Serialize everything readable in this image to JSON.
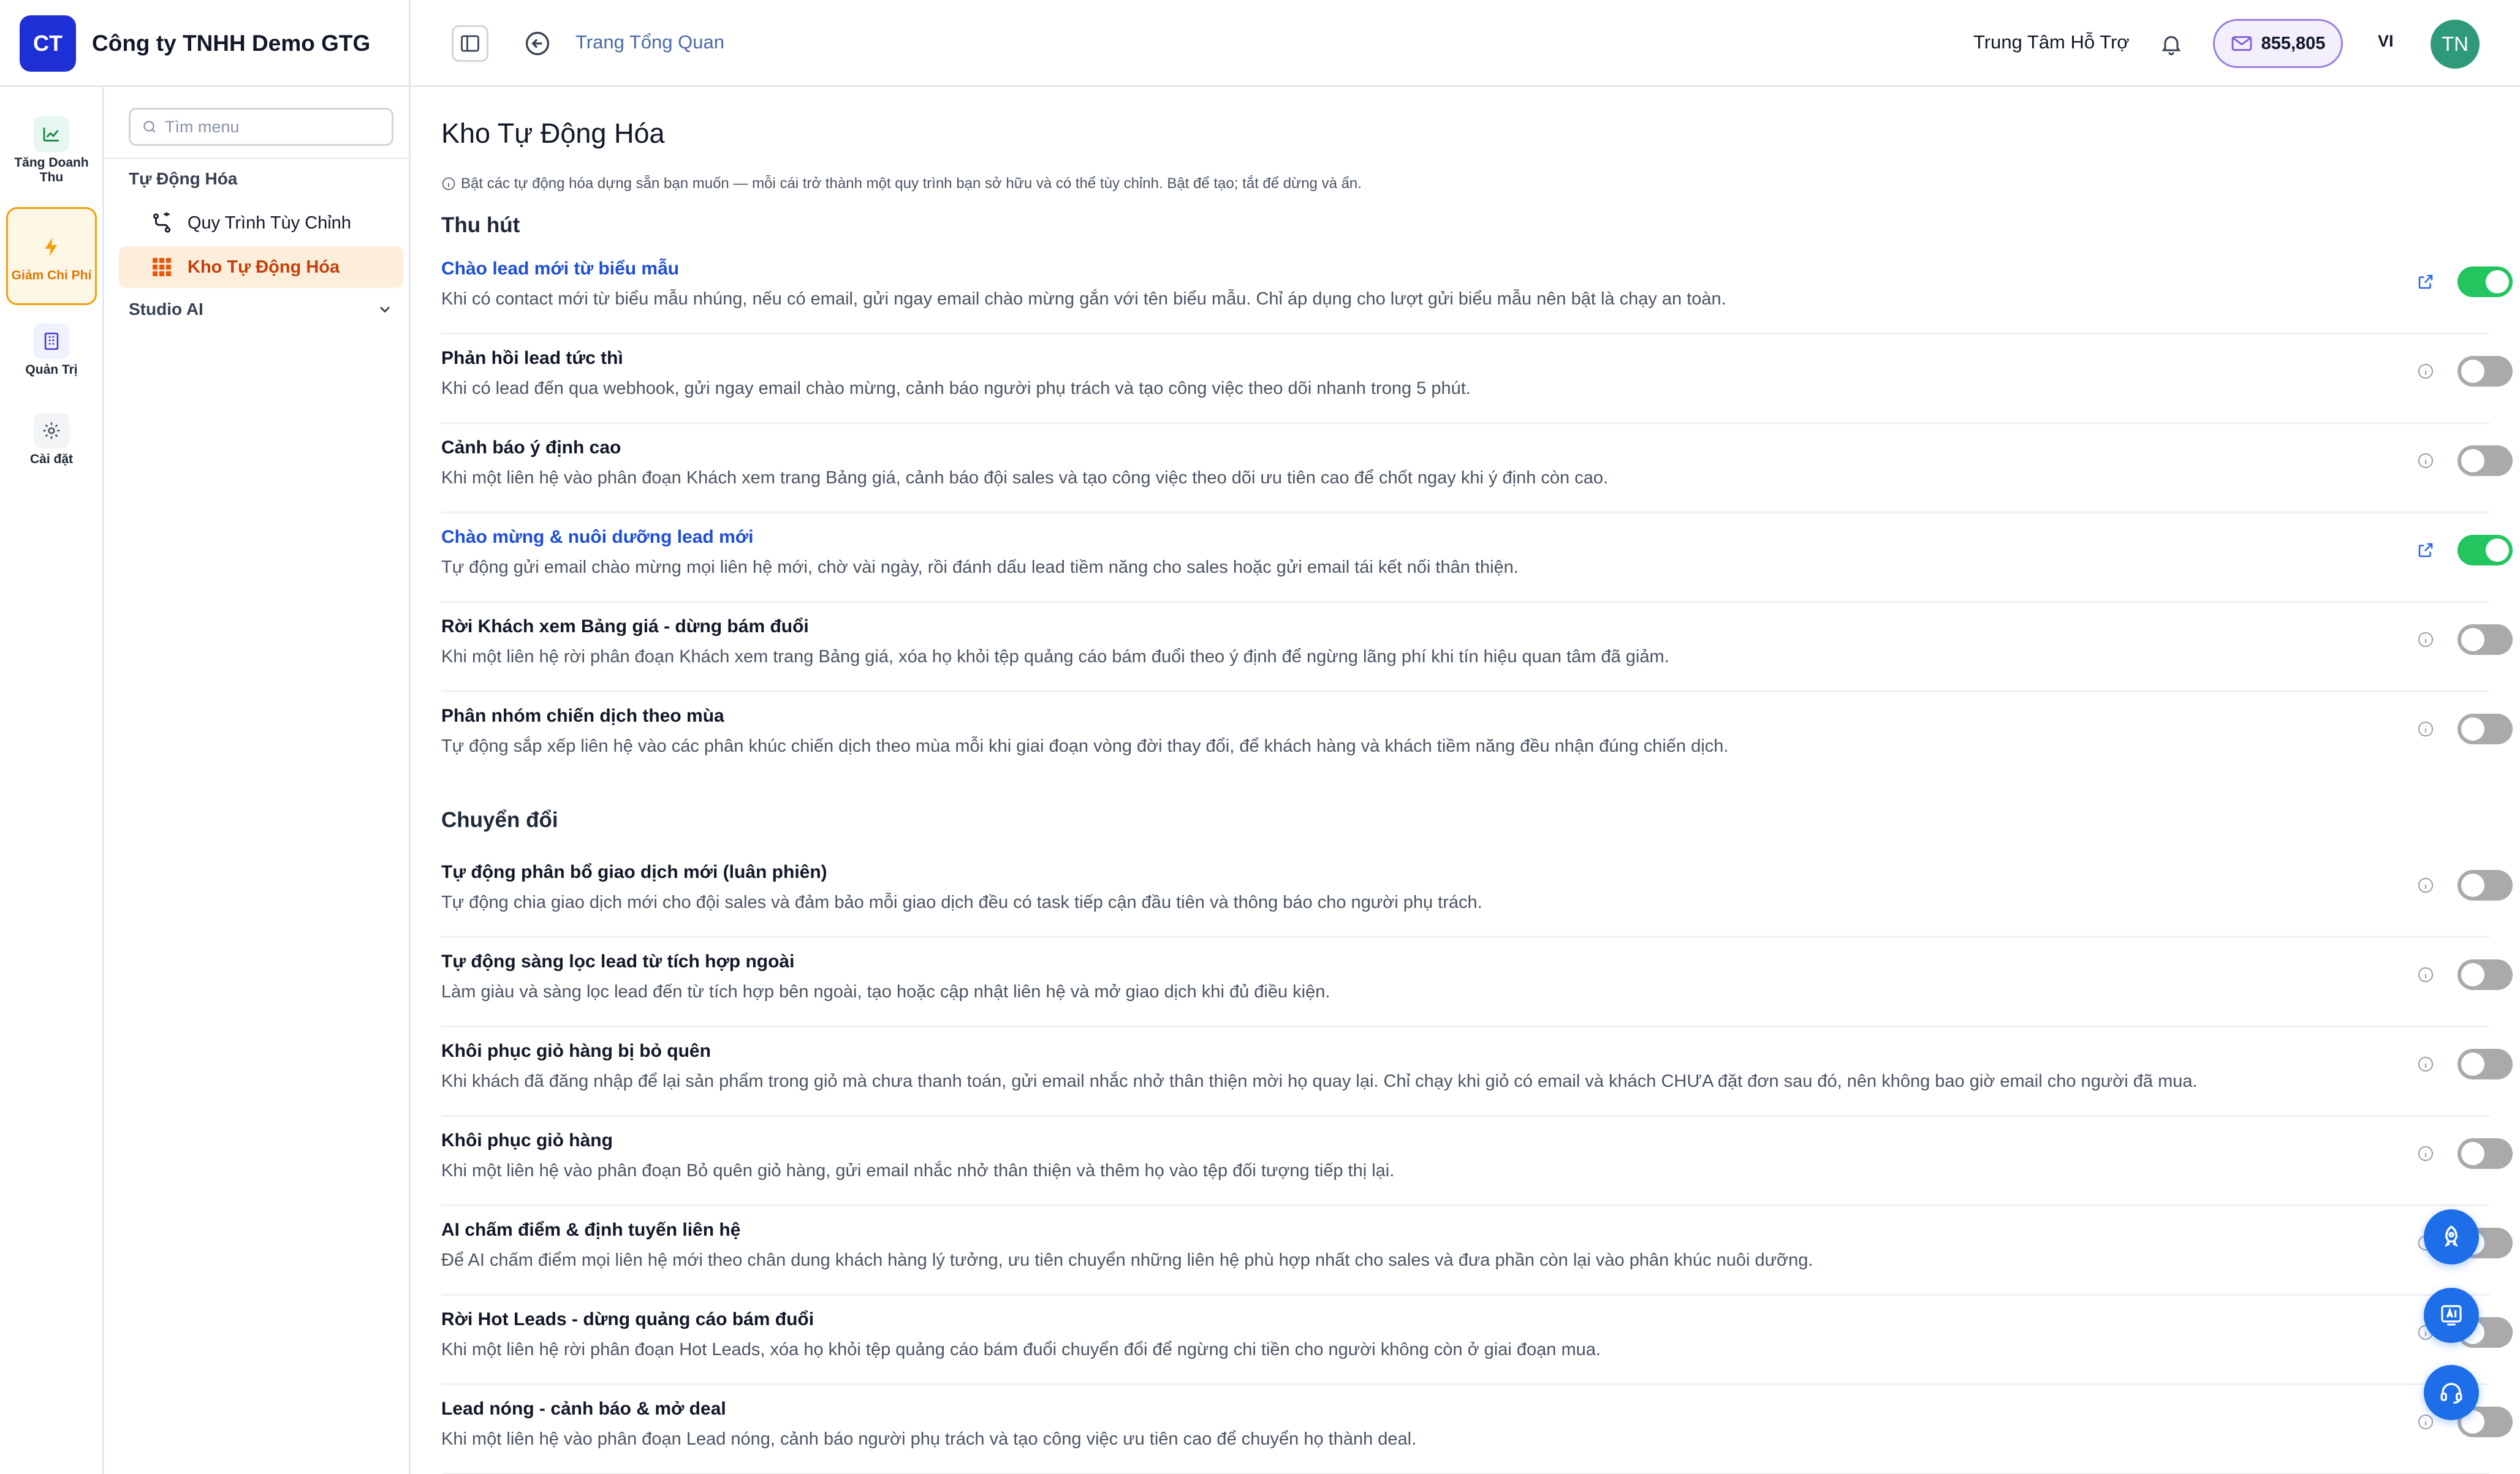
{
  "company": {
    "logo_text": "CT",
    "name": "Công ty TNHH Demo GTG"
  },
  "header": {
    "breadcrumb": "Trang Tổng Quan",
    "support_label": "Trung Tâm Hỗ Trợ",
    "credits": "855,805",
    "language": "VI",
    "avatar_initials": "TN"
  },
  "rail": [
    {
      "label": "Tăng Doanh Thu",
      "icon": "trending-up-icon"
    },
    {
      "label": "Giảm Chi Phí",
      "icon": "lightning-icon",
      "active": true
    },
    {
      "label": "Quản Trị",
      "icon": "building-icon"
    },
    {
      "label": "Cài đặt",
      "icon": "gear-icon"
    }
  ],
  "menu": {
    "search_placeholder": "Tìm menu",
    "group_label": "Tự Động Hóa",
    "items": [
      {
        "label": "Quy Trình Tùy Chỉnh",
        "icon": "workflow-icon"
      },
      {
        "label": "Kho Tự Động Hóa",
        "icon": "grid-icon",
        "active": true
      }
    ],
    "studio_label": "Studio AI"
  },
  "main": {
    "title": "Kho Tự Động Hóa",
    "info": "Bật các tự động hóa dựng sẵn bạn muốn — mỗi cái trở thành một quy trình bạn sở hữu và có thể tùy chỉnh. Bật để tạo; tắt để dừng và ẩn.",
    "sections": [
      {
        "title": "Thu hút",
        "items": [
          {
            "title": "Chào lead mới từ biểu mẫu",
            "desc": "Khi có contact mới từ biểu mẫu nhúng, nếu có email, gửi ngay email chào mừng gắn với tên biểu mẫu. Chỉ áp dụng cho lượt gửi biểu mẫu nên bật là chạy an toàn.",
            "enabled": true
          },
          {
            "title": "Phản hồi lead tức thì",
            "desc": "Khi có lead đến qua webhook, gửi ngay email chào mừng, cảnh báo người phụ trách và tạo công việc theo dõi nhanh trong 5 phút.",
            "enabled": false
          },
          {
            "title": "Cảnh báo ý định cao",
            "desc": "Khi một liên hệ vào phân đoạn Khách xem trang Bảng giá, cảnh báo đội sales và tạo công việc theo dõi ưu tiên cao để chốt ngay khi ý định còn cao.",
            "enabled": false
          },
          {
            "title": "Chào mừng & nuôi dưỡng lead mới",
            "desc": "Tự động gửi email chào mừng mọi liên hệ mới, chờ vài ngày, rồi đánh dấu lead tiềm năng cho sales hoặc gửi email tái kết nối thân thiện.",
            "enabled": true
          },
          {
            "title": "Rời Khách xem Bảng giá - dừng bám đuổi",
            "desc": "Khi một liên hệ rời phân đoạn Khách xem trang Bảng giá, xóa họ khỏi tệp quảng cáo bám đuổi theo ý định để ngừng lãng phí khi tín hiệu quan tâm đã giảm.",
            "enabled": false
          },
          {
            "title": "Phân nhóm chiến dịch theo mùa",
            "desc": "Tự động sắp xếp liên hệ vào các phân khúc chiến dịch theo mùa mỗi khi giai đoạn vòng đời thay đổi, để khách hàng và khách tiềm năng đều nhận đúng chiến dịch.",
            "enabled": false
          }
        ]
      },
      {
        "title": "Chuyển đổi",
        "items": [
          {
            "title": "Tự động phân bổ giao dịch mới (luân phiên)",
            "desc": "Tự động chia giao dịch mới cho đội sales và đảm bảo mỗi giao dịch đều có task tiếp cận đầu tiên và thông báo cho người phụ trách.",
            "enabled": false
          },
          {
            "title": "Tự động sàng lọc lead từ tích hợp ngoài",
            "desc": "Làm giàu và sàng lọc lead đến từ tích hợp bên ngoài, tạo hoặc cập nhật liên hệ và mở giao dịch khi đủ điều kiện.",
            "enabled": false
          },
          {
            "title": "Khôi phục giỏ hàng bị bỏ quên",
            "desc": "Khi khách đã đăng nhập để lại sản phẩm trong giỏ mà chưa thanh toán, gửi email nhắc nhở thân thiện mời họ quay lại. Chỉ chạy khi giỏ có email và khách CHƯA đặt đơn sau đó, nên không bao giờ email cho người đã mua.",
            "enabled": false
          },
          {
            "title": "Khôi phục giỏ hàng",
            "desc": "Khi một liên hệ vào phân đoạn Bỏ quên giỏ hàng, gửi email nhắc nhở thân thiện và thêm họ vào tệp đối tượng tiếp thị lại.",
            "enabled": false
          },
          {
            "title": "AI chấm điểm & định tuyến liên hệ",
            "desc": "Để AI chấm điểm mọi liên hệ mới theo chân dung khách hàng lý tưởng, ưu tiên chuyển những liên hệ phù hợp nhất cho sales và đưa phần còn lại vào phân khúc nuôi dưỡng.",
            "enabled": false
          },
          {
            "title": "Rời Hot Leads - dừng quảng cáo bám đuổi",
            "desc": "Khi một liên hệ rời phân đoạn Hot Leads, xóa họ khỏi tệp quảng cáo bám đuổi chuyển đổi để ngừng chi tiền cho người không còn ở giai đoạn mua.",
            "enabled": false
          },
          {
            "title": "Lead nóng - cảnh báo & mở deal",
            "desc": "Khi một liên hệ vào phân đoạn Lead nóng, cảnh báo người phụ trách và tạo công việc ưu tiên cao để chuyển họ thành deal.",
            "enabled": false
          }
        ]
      }
    ]
  },
  "fabs": [
    "rocket-icon",
    "ai-assistant-icon",
    "headset-icon"
  ],
  "colors": {
    "accent": "#1f2fd6",
    "link": "#1d4ed8",
    "toggle_on": "#22c55e",
    "toggle_off": "#aaaaaa",
    "active_orange": "#d97706",
    "credits_border": "#9b7ee0",
    "fab": "#1d6ee8"
  }
}
